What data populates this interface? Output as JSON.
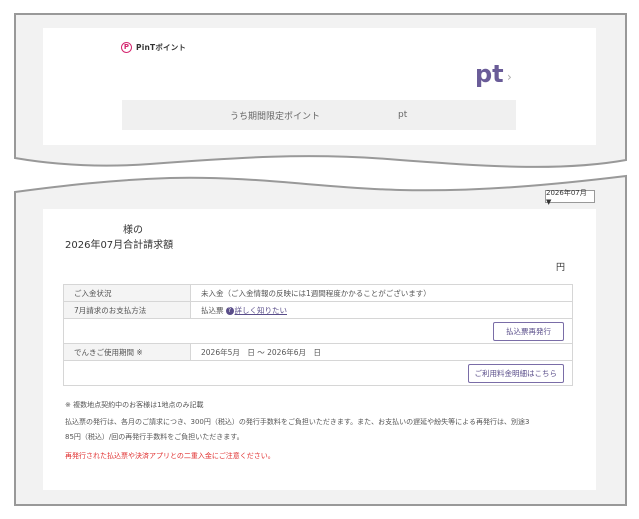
{
  "colors": {
    "brand_pink": "#d4246e",
    "accent_purple": "#6a5c98",
    "alert_red": "#e03030",
    "panel_bg": "#f2f2f2"
  },
  "top_card": {
    "logo_text": "PinTポイント",
    "logo_icon": "p-circle-icon",
    "points_unit": "pt",
    "chevron": "›",
    "limited_label": "うち期間限定ポイント",
    "limited_unit": "pt"
  },
  "bottom_card": {
    "month_select": "2026年07月 ▼",
    "customer_suffix": "様の",
    "total_title": "2026年07月合計請求額",
    "yen_unit": "円",
    "rows": {
      "payment_status_label": "ご入金状況",
      "payment_status_value": "未入金（ご入金情報の反映には1週間程度かかることがございます）",
      "payment_method_label": "7月請求のお支払方法",
      "payment_method_value": "払込票",
      "help_icon": "?",
      "help_link": "詳しく知りたい",
      "reissue_button": "払込票再発行",
      "usage_period_label": "でんきご使用期間 ※",
      "usage_period_value": "2026年5月　日 〜 2026年6月　日",
      "details_button": "ご利用料金明細はこちら"
    },
    "notes": {
      "multi_contract": "※ 複数地点契約中のお客様は1地点のみ記載",
      "fee_line1": "払込票の発行は、各月のご請求につき、300円（税込）の発行手数料をご負担いただきます。また、お支払いの遅延や紛失等による再発行は、別途3",
      "fee_line2": "85円（税込）/回の再発行手数料をご負担いただきます。",
      "warning": "再発行された払込票や決済アプリとの二重入金にご注意ください。"
    }
  }
}
